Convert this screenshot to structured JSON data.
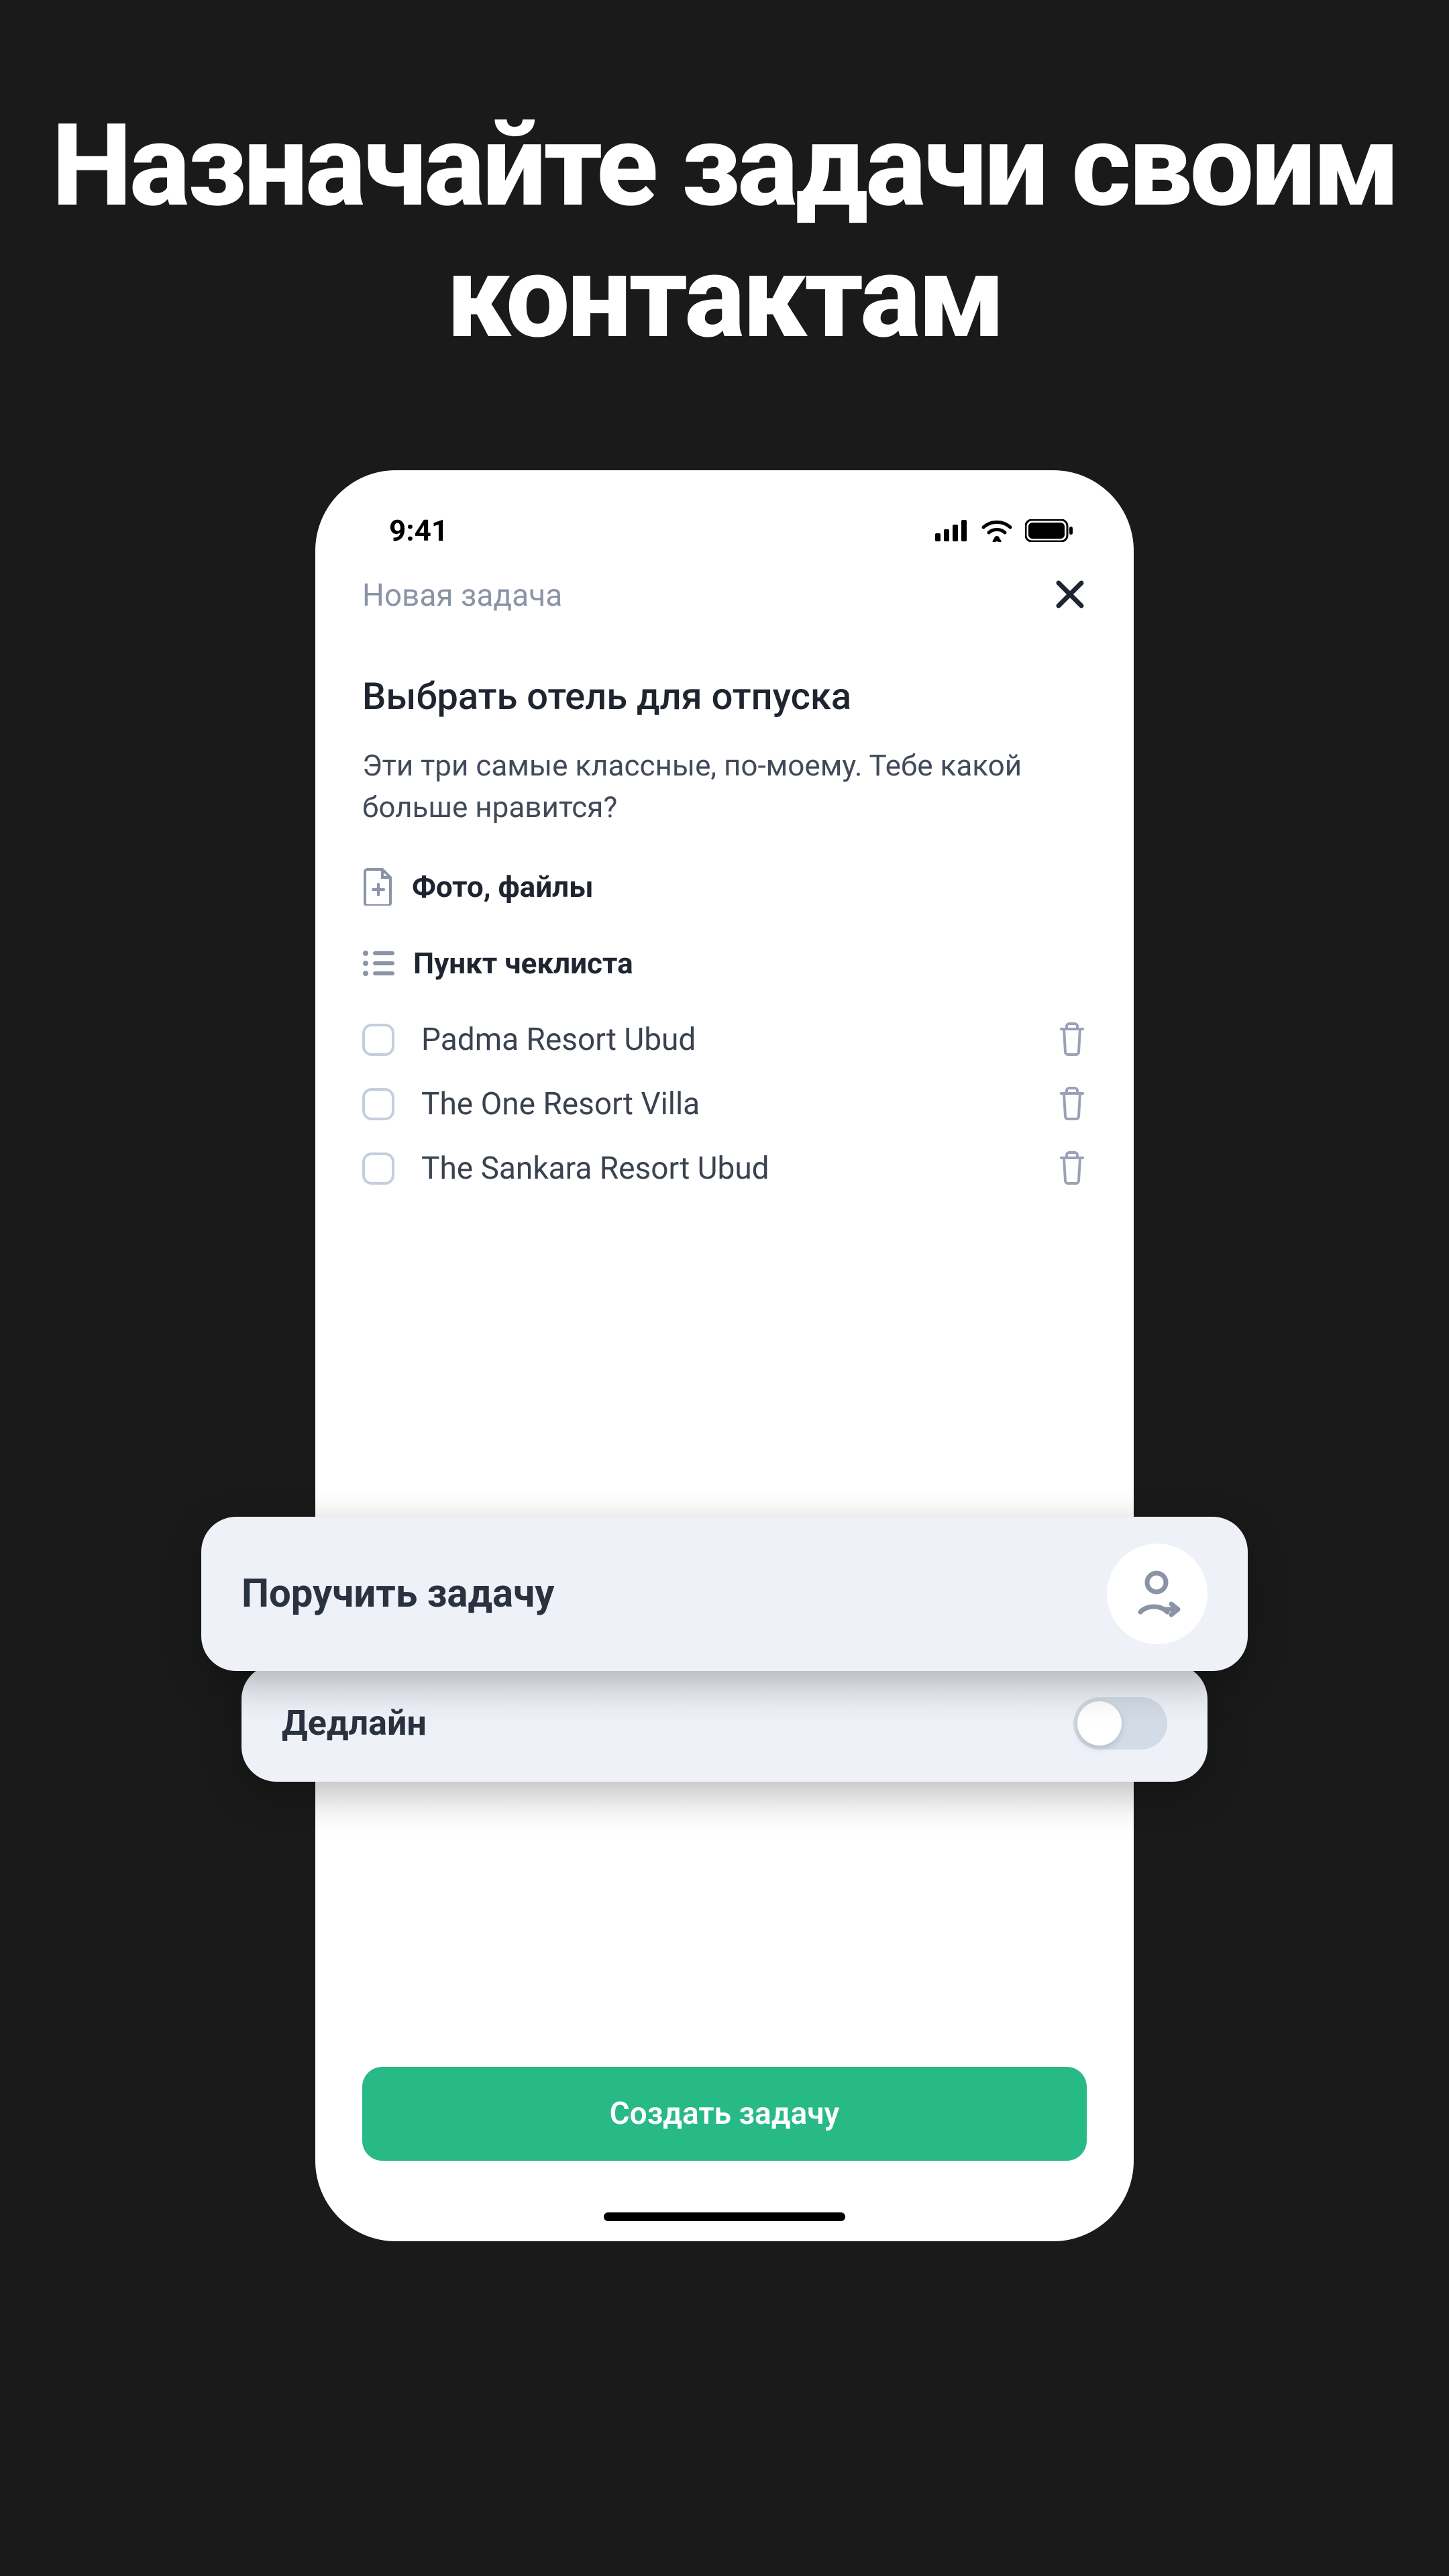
{
  "headline": "Назначайте задачи своим контактам",
  "status": {
    "time": "9:41"
  },
  "screen": {
    "header_title": "Новая задача",
    "task_title": "Выбрать отель для отпуска",
    "task_desc": "Эти три самые классные, по-моему. Тебе какой больше нравится?",
    "attach_label": "Фото, файлы",
    "checklist_header": "Пункт чеклиста",
    "checklist": [
      {
        "label": "Padma Resort Ubud"
      },
      {
        "label": "The One Resort Villa"
      },
      {
        "label": "The Sankara Resort Ubud"
      }
    ],
    "cta": "Создать задачу"
  },
  "cards": {
    "assign_label": "Поручить задачу",
    "deadline_label": "Дедлайн"
  }
}
